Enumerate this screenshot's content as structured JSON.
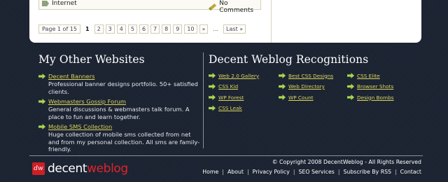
{
  "post_meta": {
    "category": "Internet",
    "comments": "No Comments"
  },
  "pagination": {
    "info": "Page 1 of 15",
    "pages": [
      "1",
      "2",
      "3",
      "4",
      "5",
      "6",
      "7",
      "8",
      "9",
      "10"
    ],
    "current": "1",
    "next": "»",
    "ellipsis": "...",
    "last": "Last »"
  },
  "other_sites": {
    "title": "My Other Websites",
    "items": [
      {
        "name": "Decent Banners",
        "desc": "Professional banner designs portfolio. 50+ satisfied clients."
      },
      {
        "name": "Webmasters Gossip Forum",
        "desc": "General discussions & webmasters talk forum. A place to fun and learn together."
      },
      {
        "name": "Mobile SMS Collection",
        "desc": "Huge collection of mobile sms collected from net and from my personal collection. All sms are family-friendly."
      }
    ]
  },
  "recognitions": {
    "title": "Decent Weblog Recognitions",
    "col1": [
      "Web 2.0 Gallery",
      "CSS Kid",
      "WP Forest",
      "CSS Leak"
    ],
    "col2": [
      "Best CSS Designs",
      "Web Directory",
      "WP Count"
    ],
    "col3": [
      "CSS Elite",
      "Browser Shots",
      "Design Bombs"
    ]
  },
  "footer": {
    "logo_mark": "dw",
    "logo_text_a": "decent",
    "logo_text_b": "weblog",
    "copyright": "© Copyright 2008 DecentWeblog - All Rights Reserved",
    "nav": [
      "Home",
      "About",
      "Privacy Policy",
      "SEO Services",
      "Subscribe By RSS",
      "Contact"
    ],
    "separator": "|"
  },
  "colors": {
    "background": "#1c2433",
    "link": "#d9d45c",
    "arrow": "#a9d64f",
    "brand_red": "#e0242c"
  }
}
